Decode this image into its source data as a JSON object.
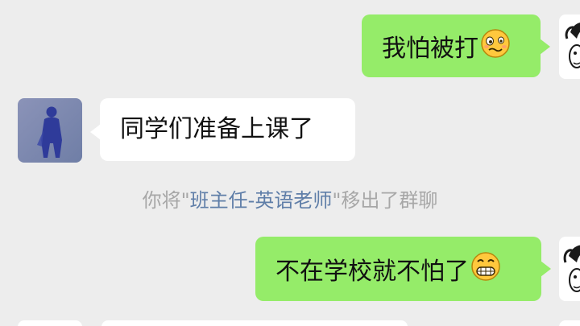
{
  "messages": [
    {
      "direction": "out",
      "text": "我怕被打",
      "emoji": "woozy-face-emoji"
    },
    {
      "direction": "in",
      "text": "同学们准备上课了"
    },
    {
      "direction": "out",
      "text": "不在学校就不怕了",
      "emoji": "grimacing-face-emoji"
    }
  ],
  "system_notice": {
    "prefix": "你将\"",
    "name": "班主任-英语老师",
    "suffix": "\"移出了群聊"
  },
  "colors": {
    "background": "#ededed",
    "outgoing_bubble": "#95ec69",
    "incoming_bubble": "#ffffff",
    "system_text": "#a7a7a7",
    "system_link": "#5f7ea8"
  }
}
